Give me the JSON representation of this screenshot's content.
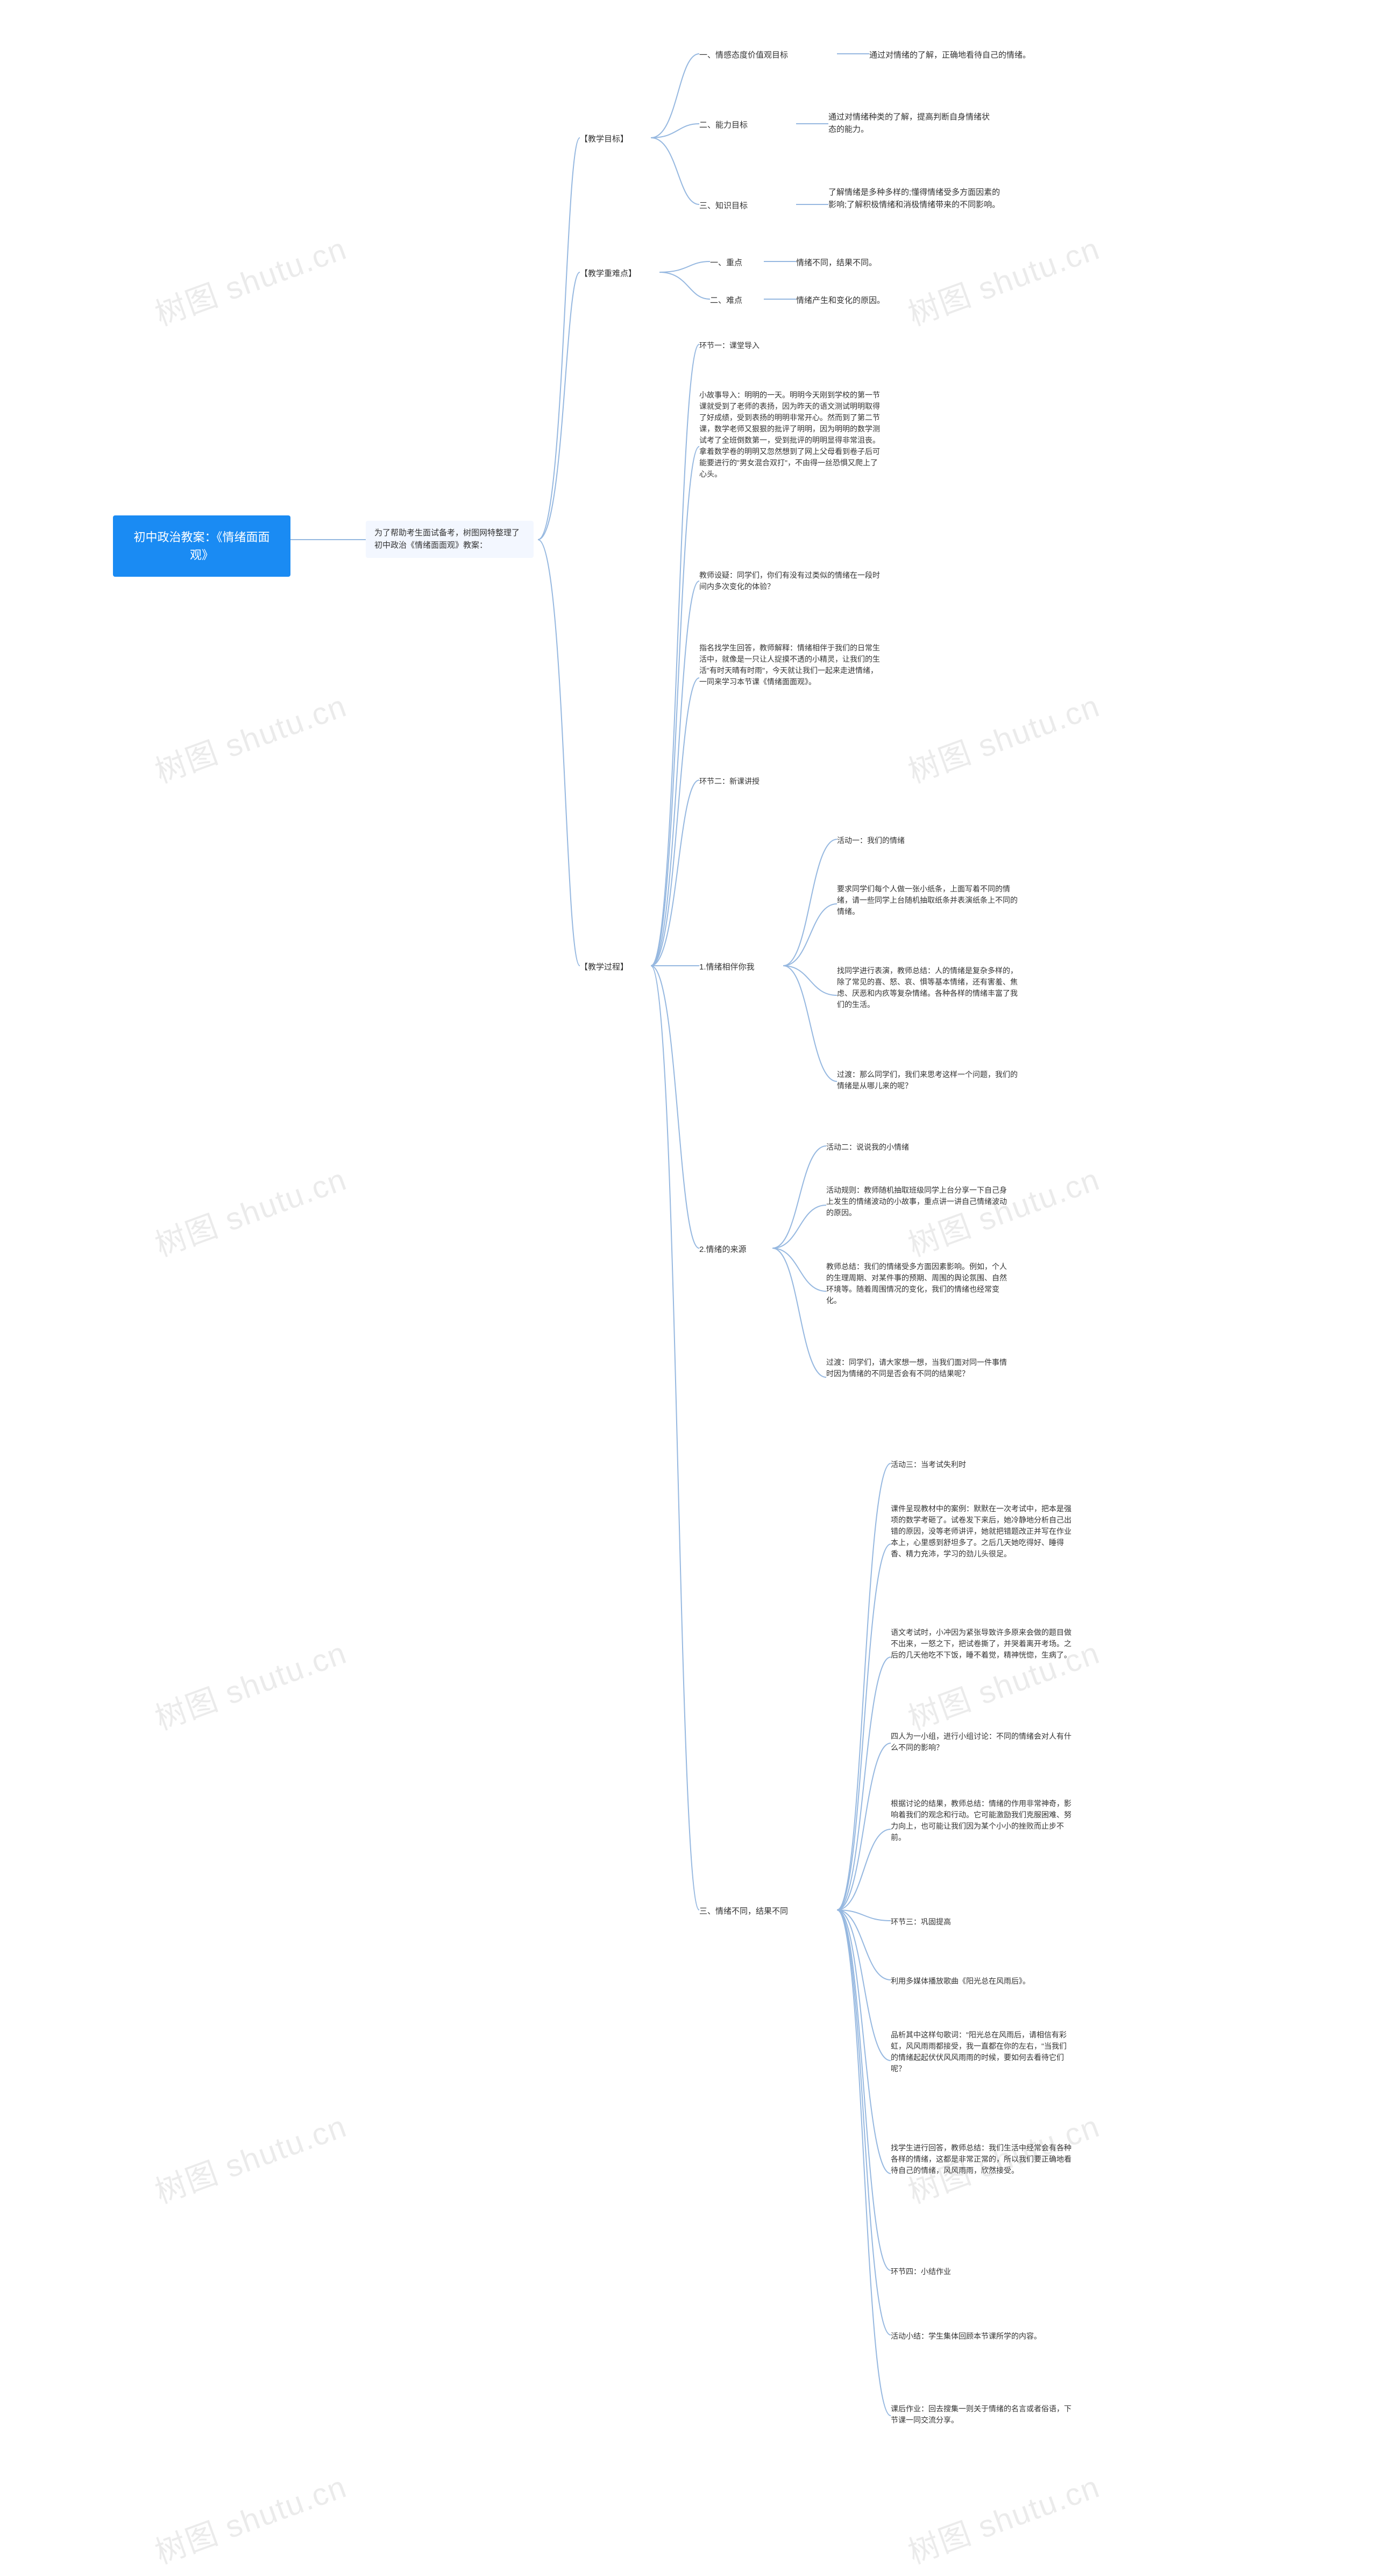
{
  "watermark": "树图 shutu.cn",
  "root": {
    "title": "初中政治教案：《情绪面面观》"
  },
  "intro": "为了帮助考生面试备考，树图网特整理了初中政治《情绪面面观》教案：",
  "s1": {
    "title": "【教学目标】",
    "items": [
      {
        "label": "一、情感态度价值观目标",
        "text": "通过对情绪的了解，正确地看待自己的情绪。"
      },
      {
        "label": "二、能力目标",
        "text": "通过对情绪种类的了解，提高判断自身情绪状态的能力。"
      },
      {
        "label": "三、知识目标",
        "text": "了解情绪是多种多样的;懂得情绪受多方面因素的影响;了解积极情绪和消极情绪带来的不同影响。"
      }
    ]
  },
  "s2": {
    "title": "【教学重难点】",
    "items": [
      {
        "label": "一、重点",
        "text": "情绪不同，结果不同。"
      },
      {
        "label": "二、难点",
        "text": "情绪产生和变化的原因。"
      }
    ]
  },
  "s3": {
    "title": "【教学过程】",
    "intro": [
      "环节一：课堂导入",
      "小故事导入：明明的一天。明明今天刚到学校的第一节课就受到了老师的表扬，因为昨天的语文测试明明取得了好成绩，受到表扬的明明非常开心。然而到了第二节课，数学老师又狠狠的批评了明明，因为明明的数学测试考了全班倒数第一，受到批评的明明显得非常沮丧。拿着数学卷的明明又忽然想到了网上父母看到卷子后可能要进行的\"男女混合双打\"，不由得一丝恐惧又爬上了心头。",
      "教师设疑：同学们，你们有没有过类似的情绪在一段时间内多次变化的体验？",
      "指名找学生回答，教师解释：情绪相伴于我们的日常生活中，就像是一只让人捉摸不透的小精灵，让我们的生活\"有时天晴有时雨\"，今天就让我们一起来走进情绪，一同来学习本节课《情绪面面观》。",
      "环节二：新课讲授"
    ],
    "sub1": {
      "title": "1.情绪相伴你我",
      "items": [
        "活动一：我们的情绪",
        "要求同学们每个人做一张小纸条，上面写着不同的情绪，请一些同学上台随机抽取纸条并表演纸条上不同的情绪。",
        "找同学进行表演，教师总结：人的情绪是复杂多样的，除了常见的喜、怒、哀、惧等基本情绪，还有害羞、焦虑、厌恶和内疚等复杂情绪。各种各样的情绪丰富了我们的生活。",
        "过渡：那么同学们，我们来思考这样一个问题，我们的情绪是从哪儿来的呢？"
      ]
    },
    "sub2": {
      "title": "2.情绪的来源",
      "items": [
        "活动二：说说我的小情绪",
        "活动规则：教师随机抽取班级同学上台分享一下自己身上发生的情绪波动的小故事，重点讲一讲自己情绪波动的原因。",
        "教师总结：我们的情绪受多方面因素影响。例如，个人的生理周期、对某件事的预期、周围的舆论氛围、自然环境等。随着周围情况的变化，我们的情绪也经常变化。",
        "过渡：同学们，请大家想一想，当我们面对同一件事情时因为情绪的不同是否会有不同的结果呢？"
      ]
    },
    "sub3": {
      "title": "三、情绪不同，结果不同",
      "items": [
        "活动三：当考试失利时",
        "课件呈现教材中的案例：默默在一次考试中，把本是强项的数学考砸了。试卷发下来后，她冷静地分析自己出错的原因，没等老师讲评，她就把错题改正并写在作业本上，心里感到舒坦多了。之后几天她吃得好、睡得香、精力充沛，学习的劲儿头很足。",
        "语文考试时，小冲因为紧张导致许多原来会做的题目做不出来，一怒之下，把试卷撕了，并哭着离开考场。之后的几天他吃不下饭，睡不着觉，精神恍惚，生病了。",
        "四人为一小组，进行小组讨论：不同的情绪会对人有什么不同的影响？",
        "根据讨论的结果，教师总结：情绪的作用非常神奇，影响着我们的观念和行动。它可能激励我们克服困难、努力向上，也可能让我们因为某个小小的挫败而止步不前。",
        "环节三：巩固提高",
        "利用多媒体播放歌曲《阳光总在风雨后》。",
        "品析其中这样句歌词：\"阳光总在风雨后，请相信有彩虹，风风雨雨都接受，我一直都在你的左右，\"当我们的情绪起起伏伏风风雨雨的时候，要如何去看待它们呢？",
        "找学生进行回答，教师总结：我们生活中经常会有各种各样的情绪，这都是非常正常的，所以我们要正确地看待自己的情绪，风风雨雨，欣然接受。",
        "环节四：小结作业",
        "活动小结：学生集体回顾本节课所学的内容。",
        "课后作业：回去搜集一则关于情绪的名言或者俗语，下节课一同交流分享。"
      ]
    }
  }
}
